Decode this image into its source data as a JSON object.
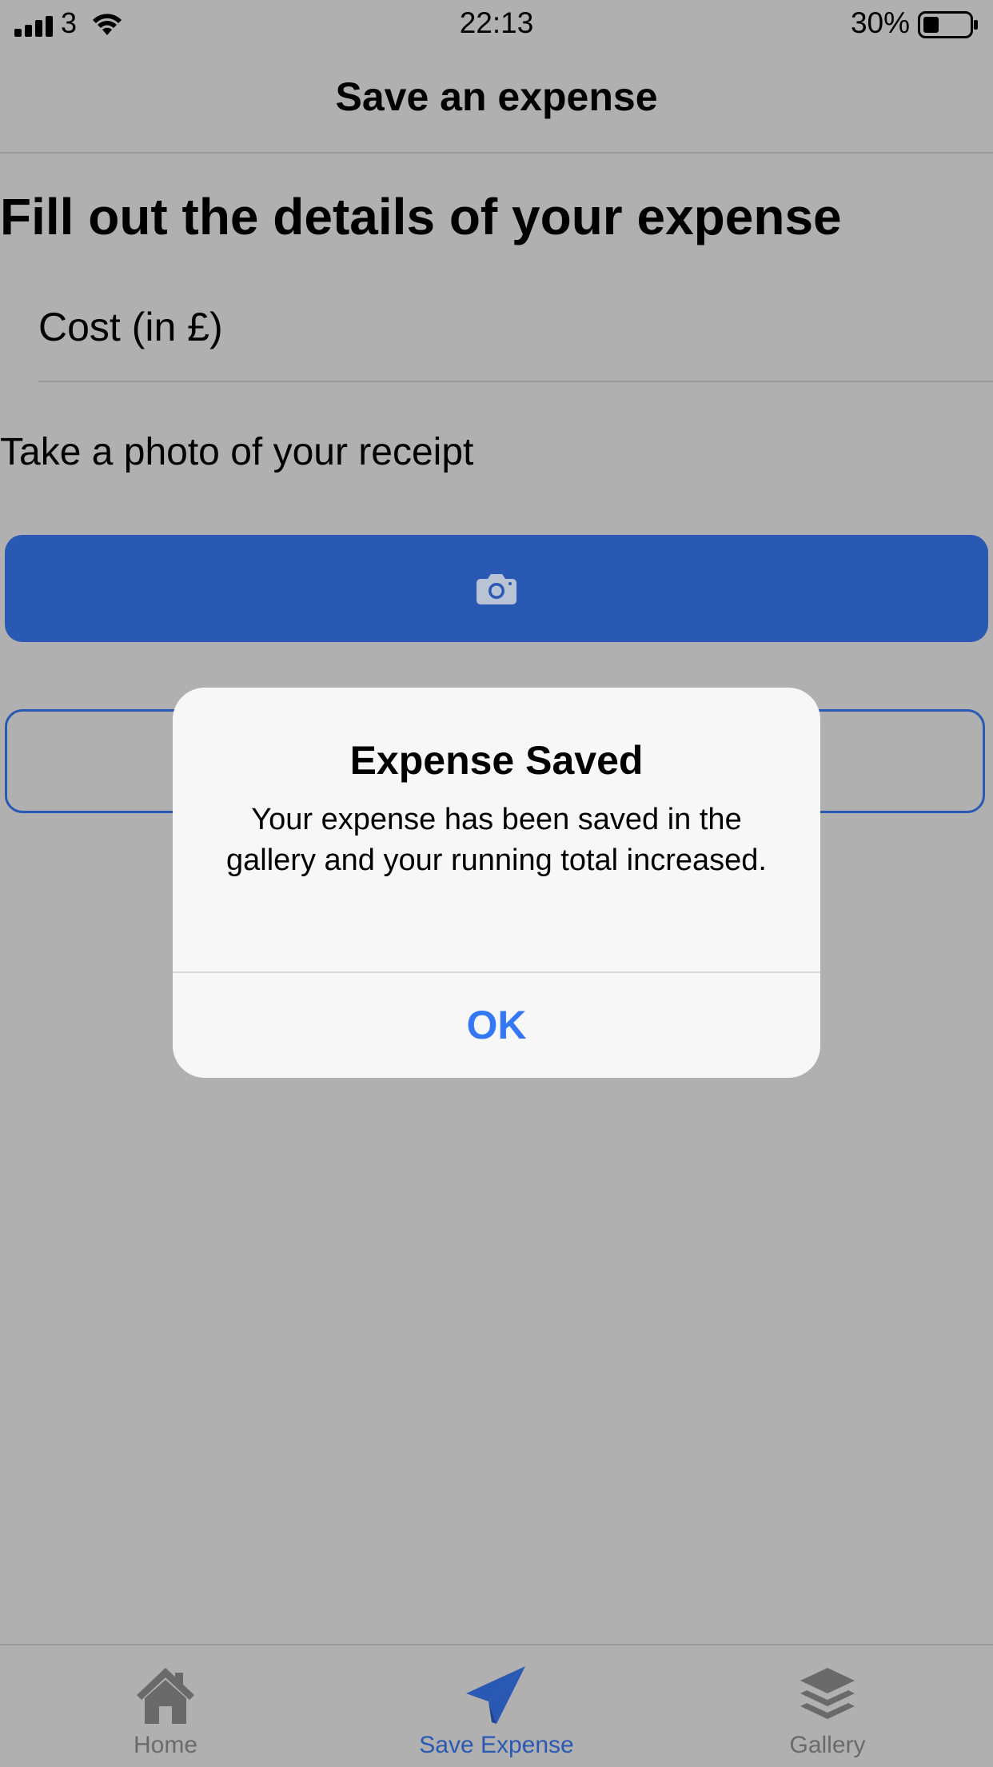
{
  "status_bar": {
    "carrier": "3",
    "time": "22:13",
    "battery": "30%",
    "icons": [
      "signal-bars-icon",
      "wifi-icon",
      "battery-icon"
    ]
  },
  "nav": {
    "title": "Save an expense"
  },
  "form": {
    "heading": "Fill out the details of your expense",
    "cost_placeholder": "Cost (in £)",
    "photo_label": "Take a photo of your receipt",
    "camera_icon": "camera-icon"
  },
  "alert": {
    "title": "Expense Saved",
    "message": "Your expense has been saved in the gallery and your running total increased.",
    "ok_label": "OK"
  },
  "tabs": [
    {
      "label": "Home",
      "icon": "home-icon",
      "active": false
    },
    {
      "label": "Save Expense",
      "icon": "paper-plane-icon",
      "active": true
    },
    {
      "label": "Gallery",
      "icon": "layers-icon",
      "active": false
    }
  ],
  "colors": {
    "accent": "#2a59b3",
    "alert_button": "#3478f6",
    "dim_background": "#b0b0b0",
    "tab_inactive": "#6a6a6a"
  }
}
